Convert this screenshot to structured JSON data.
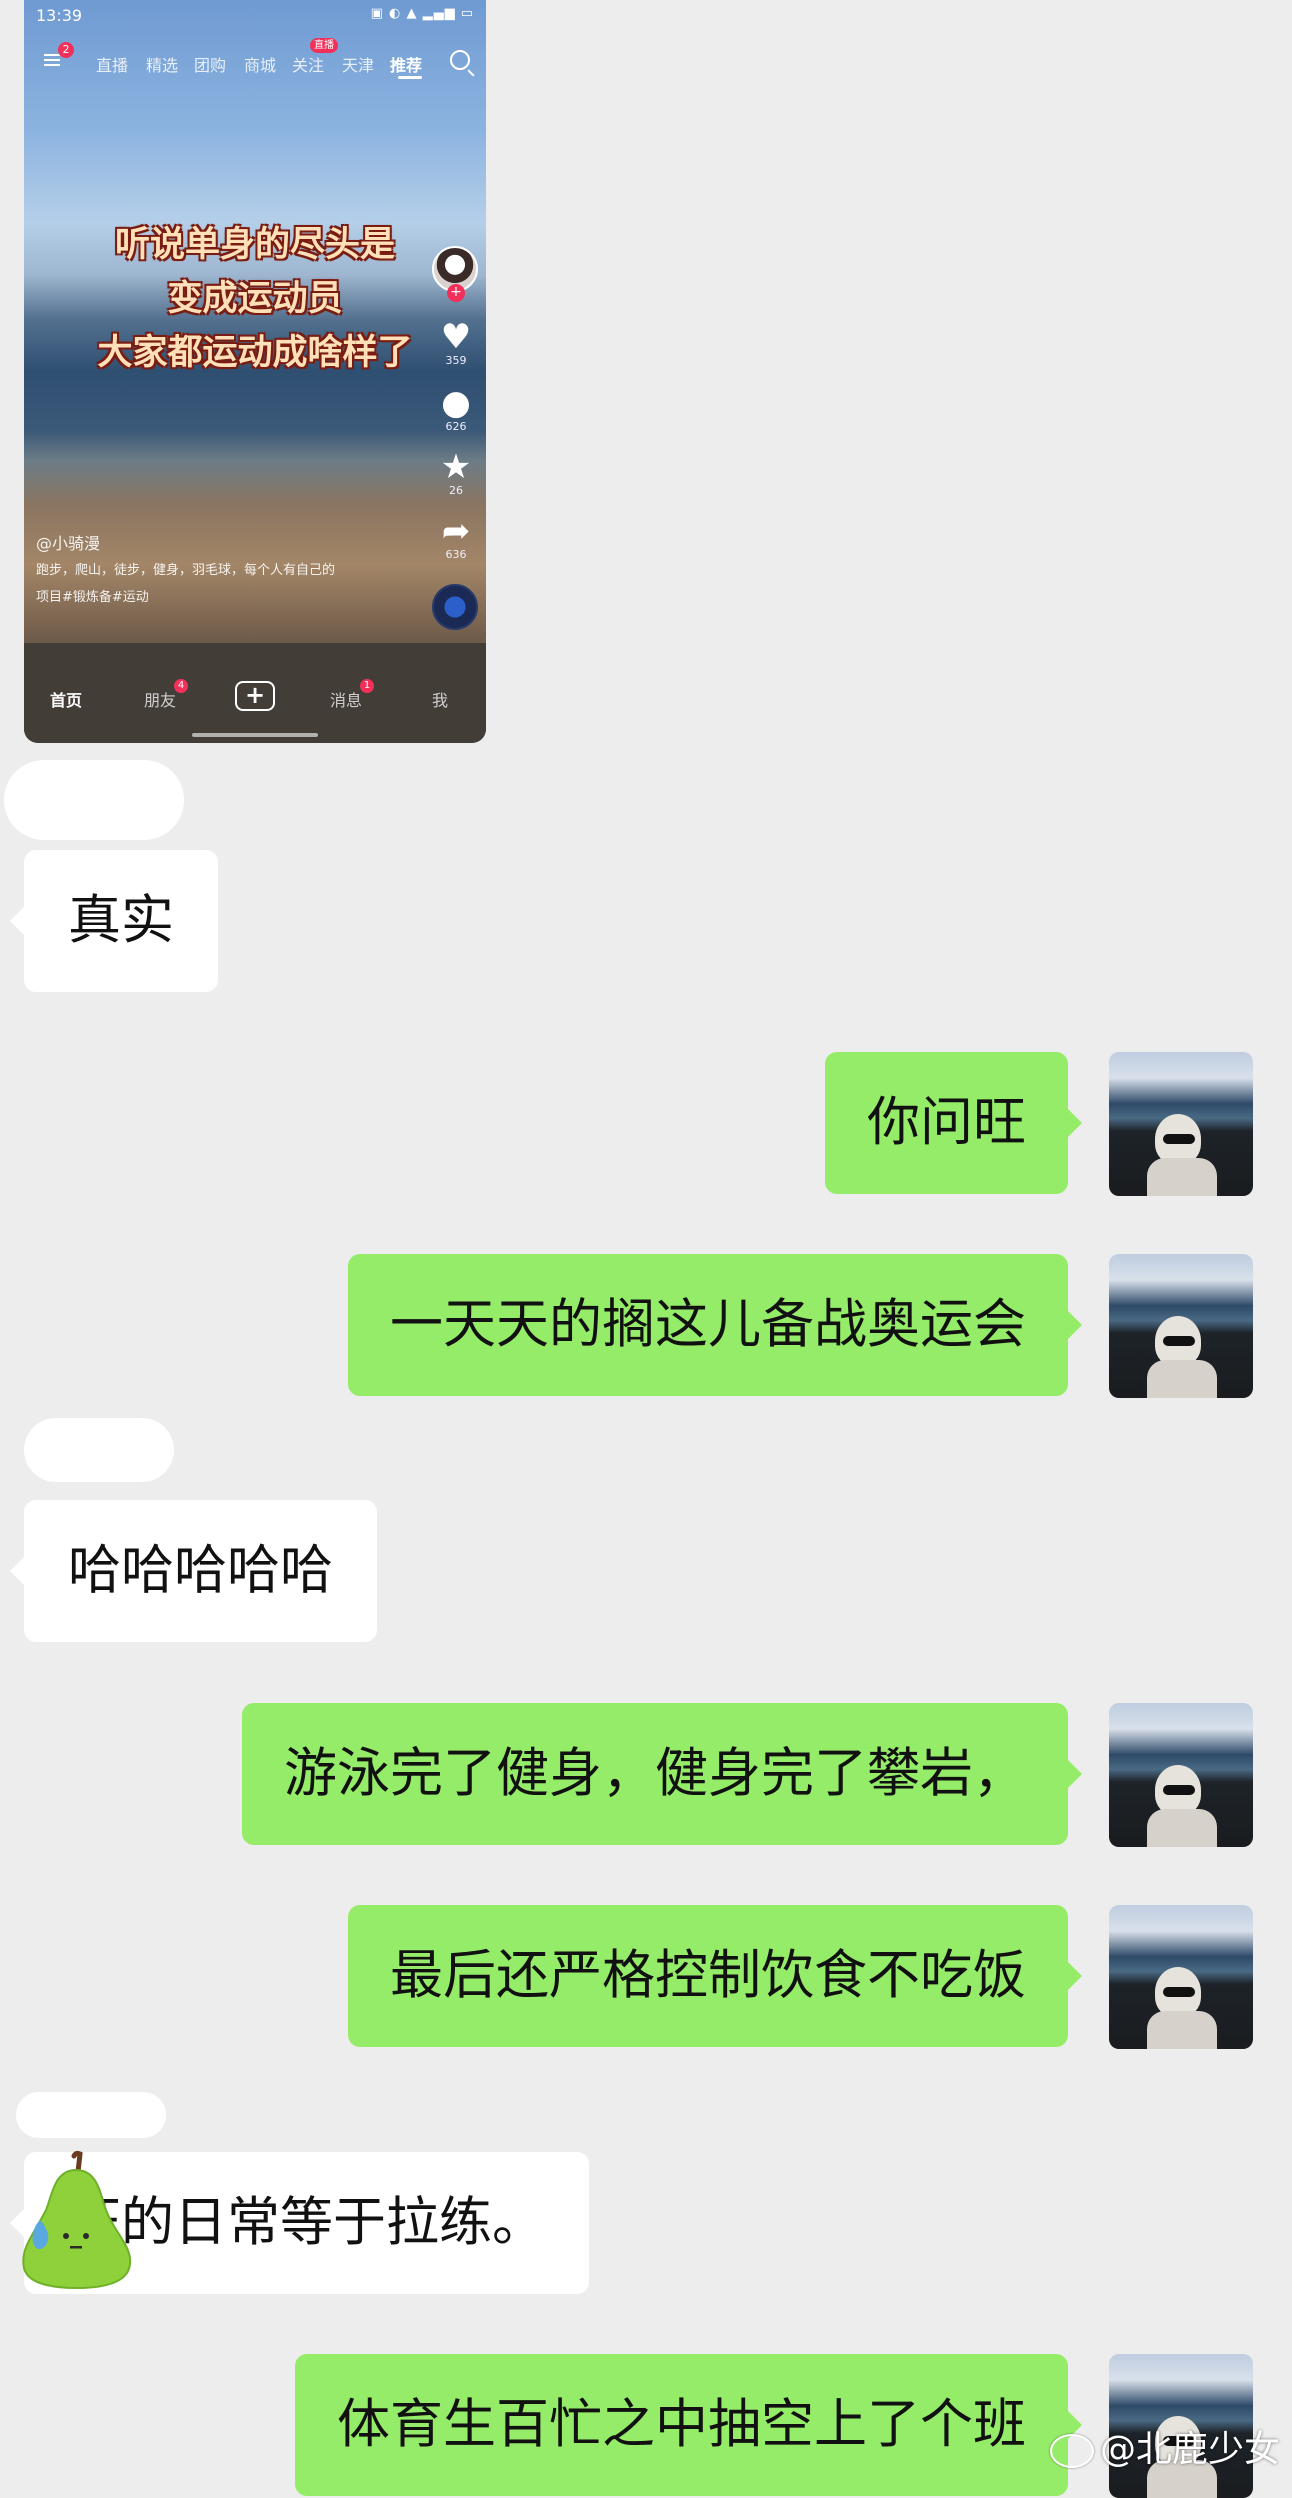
{
  "video": {
    "status": {
      "time": "13:39"
    },
    "menu_badge": "2",
    "nav_tabs": [
      "直播",
      "精选",
      "团购",
      "商城",
      "关注",
      "天津",
      "推荐"
    ],
    "live_badge": "直播",
    "caption": [
      "听说单身的尽头是",
      "变成运动员",
      "大家都运动成啥样了"
    ],
    "stats": {
      "likes": "359",
      "comments": "626",
      "favorites": "26",
      "shares": "636"
    },
    "author": "@小骑漫",
    "description": "跑步，爬山，徒步，健身，羽毛球，每个人有自己的",
    "tags": "项目#锻炼备#运动",
    "bottom_tabs": {
      "home": "首页",
      "friends": "朋友",
      "friends_badge": "4",
      "messages": "消息",
      "messages_badge": "1",
      "me": "我"
    }
  },
  "messages": [
    {
      "side": "in",
      "text": "真实"
    },
    {
      "side": "out",
      "text": "你问旺"
    },
    {
      "side": "out",
      "text": "一天天的搁这儿备战奥运会"
    },
    {
      "side": "in",
      "text": "哈哈哈哈哈"
    },
    {
      "side": "out",
      "text": "游泳完了健身，健身完了攀岩，"
    },
    {
      "side": "out",
      "text": "最后还严格控制饮食不吃饭"
    },
    {
      "side": "in",
      "text": "旺的日常等于拉练。"
    },
    {
      "side": "out",
      "text": "体育生百忙之中抽空上了个班"
    }
  ],
  "watermark": "@北鹿少女",
  "colors": {
    "chat_bg": "#ededed",
    "outgoing_bubble": "#95ec69",
    "incoming_bubble": "#ffffff",
    "badge": "#f2305a"
  }
}
